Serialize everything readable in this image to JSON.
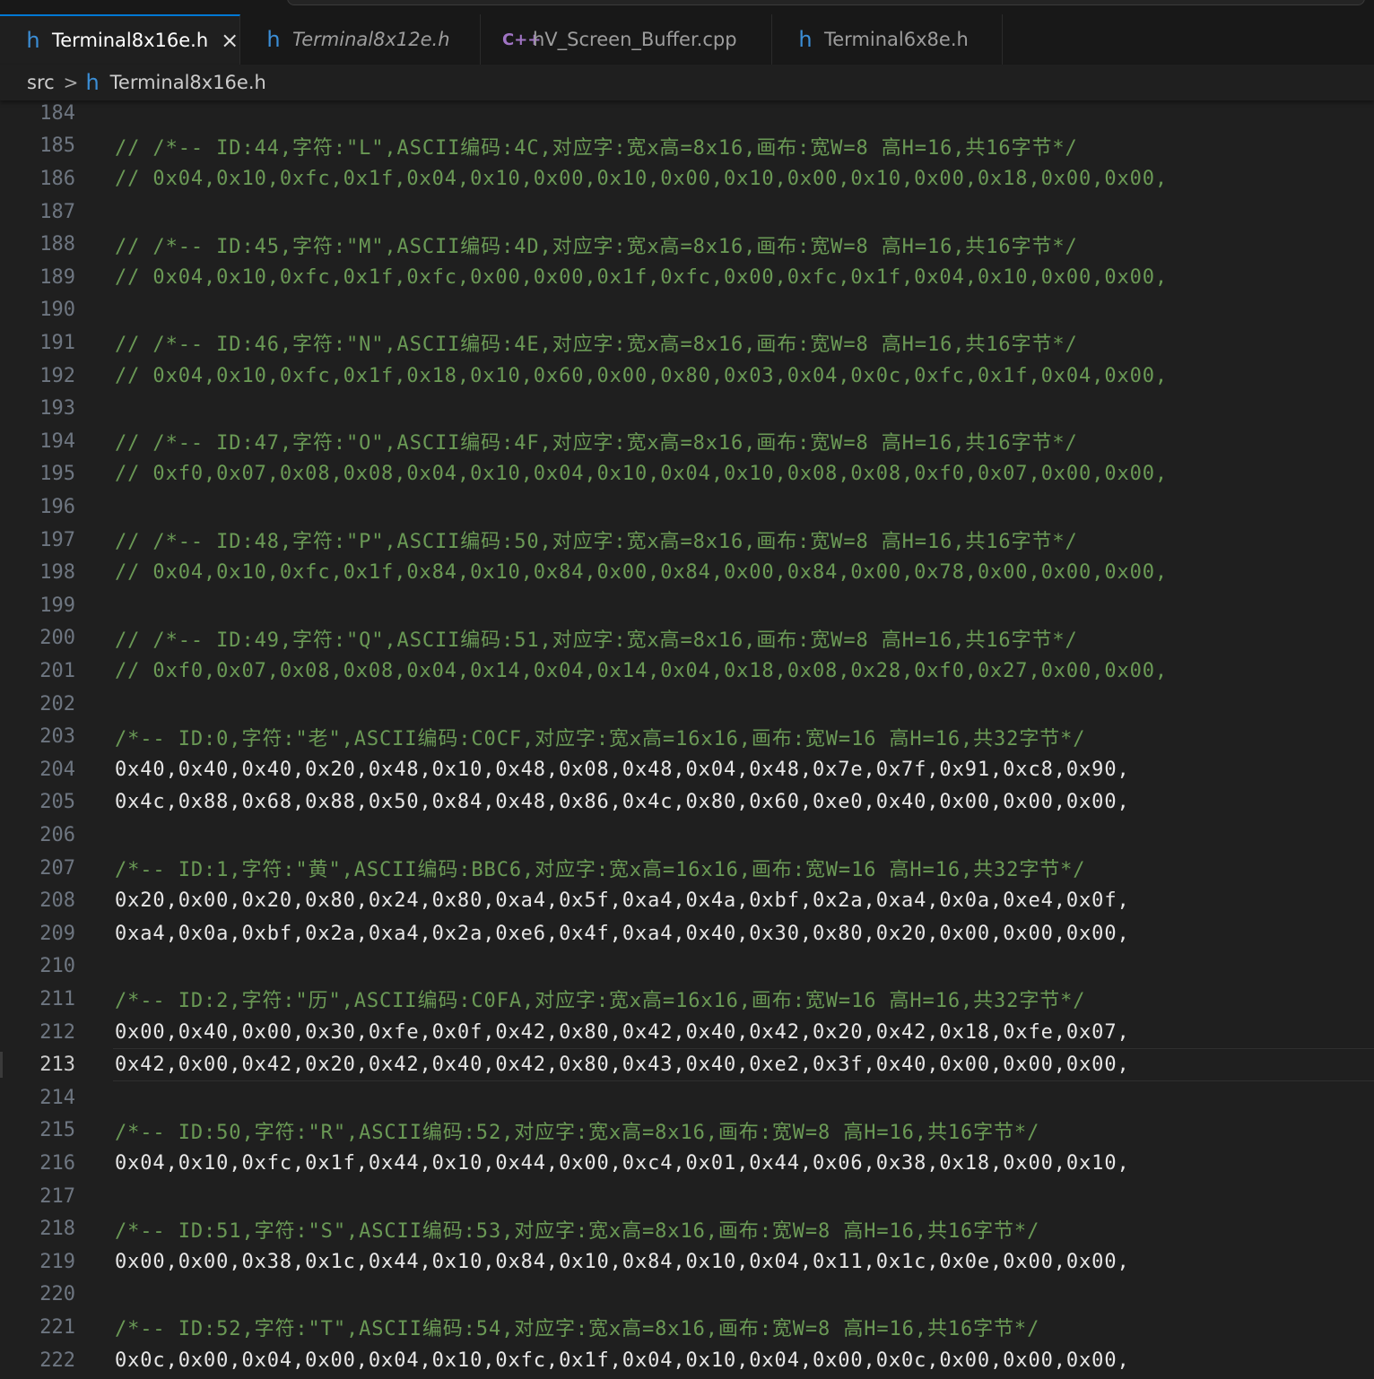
{
  "tabs": [
    {
      "icon": "h",
      "label": "Terminal8x16e.h",
      "active": true,
      "italic": false,
      "close": "×"
    },
    {
      "icon": "h",
      "label": "Terminal8x12e.h",
      "active": false,
      "italic": true
    },
    {
      "icon": "C++",
      "label": "hV_Screen_Buffer.cpp",
      "active": false,
      "italic": false
    },
    {
      "icon": "h",
      "label": "Terminal6x8e.h",
      "active": false,
      "italic": false
    }
  ],
  "breadcrumb": {
    "folder": "src",
    "separator": ">",
    "file_icon": "h",
    "file": "Terminal8x16e.h"
  },
  "editor": {
    "current_line": "213",
    "lines": [
      {
        "n": "184",
        "t": "",
        "k": "data"
      },
      {
        "n": "185",
        "t": "// /*-- ID:44,字符:\"L\",ASCII编码:4C,对应字:宽x高=8x16,画布:宽W=8 高H=16,共16字节*/",
        "k": "comment"
      },
      {
        "n": "186",
        "t": "// 0x04,0x10,0xfc,0x1f,0x04,0x10,0x00,0x10,0x00,0x10,0x00,0x10,0x00,0x18,0x00,0x00,",
        "k": "comment"
      },
      {
        "n": "187",
        "t": "",
        "k": "data"
      },
      {
        "n": "188",
        "t": "// /*-- ID:45,字符:\"M\",ASCII编码:4D,对应字:宽x高=8x16,画布:宽W=8 高H=16,共16字节*/",
        "k": "comment"
      },
      {
        "n": "189",
        "t": "// 0x04,0x10,0xfc,0x1f,0xfc,0x00,0x00,0x1f,0xfc,0x00,0xfc,0x1f,0x04,0x10,0x00,0x00,",
        "k": "comment"
      },
      {
        "n": "190",
        "t": "",
        "k": "data"
      },
      {
        "n": "191",
        "t": "// /*-- ID:46,字符:\"N\",ASCII编码:4E,对应字:宽x高=8x16,画布:宽W=8 高H=16,共16字节*/",
        "k": "comment"
      },
      {
        "n": "192",
        "t": "// 0x04,0x10,0xfc,0x1f,0x18,0x10,0x60,0x00,0x80,0x03,0x04,0x0c,0xfc,0x1f,0x04,0x00,",
        "k": "comment"
      },
      {
        "n": "193",
        "t": "",
        "k": "data"
      },
      {
        "n": "194",
        "t": "// /*-- ID:47,字符:\"O\",ASCII编码:4F,对应字:宽x高=8x16,画布:宽W=8 高H=16,共16字节*/",
        "k": "comment"
      },
      {
        "n": "195",
        "t": "// 0xf0,0x07,0x08,0x08,0x04,0x10,0x04,0x10,0x04,0x10,0x08,0x08,0xf0,0x07,0x00,0x00,",
        "k": "comment"
      },
      {
        "n": "196",
        "t": "",
        "k": "data"
      },
      {
        "n": "197",
        "t": "// /*-- ID:48,字符:\"P\",ASCII编码:50,对应字:宽x高=8x16,画布:宽W=8 高H=16,共16字节*/",
        "k": "comment"
      },
      {
        "n": "198",
        "t": "// 0x04,0x10,0xfc,0x1f,0x84,0x10,0x84,0x00,0x84,0x00,0x84,0x00,0x78,0x00,0x00,0x00,",
        "k": "comment"
      },
      {
        "n": "199",
        "t": "",
        "k": "data"
      },
      {
        "n": "200",
        "t": "// /*-- ID:49,字符:\"Q\",ASCII编码:51,对应字:宽x高=8x16,画布:宽W=8 高H=16,共16字节*/",
        "k": "comment"
      },
      {
        "n": "201",
        "t": "// 0xf0,0x07,0x08,0x08,0x04,0x14,0x04,0x14,0x04,0x18,0x08,0x28,0xf0,0x27,0x00,0x00,",
        "k": "comment"
      },
      {
        "n": "202",
        "t": "",
        "k": "data"
      },
      {
        "n": "203",
        "t": "/*-- ID:0,字符:\"老\",ASCII编码:C0CF,对应字:宽x高=16x16,画布:宽W=16 高H=16,共32字节*/",
        "k": "comment"
      },
      {
        "n": "204",
        "t": "0x40,0x40,0x40,0x20,0x48,0x10,0x48,0x08,0x48,0x04,0x48,0x7e,0x7f,0x91,0xc8,0x90,",
        "k": "data"
      },
      {
        "n": "205",
        "t": "0x4c,0x88,0x68,0x88,0x50,0x84,0x48,0x86,0x4c,0x80,0x60,0xe0,0x40,0x00,0x00,0x00,",
        "k": "data"
      },
      {
        "n": "206",
        "t": "",
        "k": "data"
      },
      {
        "n": "207",
        "t": "/*-- ID:1,字符:\"黄\",ASCII编码:BBC6,对应字:宽x高=16x16,画布:宽W=16 高H=16,共32字节*/",
        "k": "comment"
      },
      {
        "n": "208",
        "t": "0x20,0x00,0x20,0x80,0x24,0x80,0xa4,0x5f,0xa4,0x4a,0xbf,0x2a,0xa4,0x0a,0xe4,0x0f,",
        "k": "data"
      },
      {
        "n": "209",
        "t": "0xa4,0x0a,0xbf,0x2a,0xa4,0x2a,0xe6,0x4f,0xa4,0x40,0x30,0x80,0x20,0x00,0x00,0x00,",
        "k": "data"
      },
      {
        "n": "210",
        "t": "",
        "k": "data"
      },
      {
        "n": "211",
        "t": "/*-- ID:2,字符:\"历\",ASCII编码:C0FA,对应字:宽x高=16x16,画布:宽W=16 高H=16,共32字节*/",
        "k": "comment"
      },
      {
        "n": "212",
        "t": "0x00,0x40,0x00,0x30,0xfe,0x0f,0x42,0x80,0x42,0x40,0x42,0x20,0x42,0x18,0xfe,0x07,",
        "k": "data"
      },
      {
        "n": "213",
        "t": "0x42,0x00,0x42,0x20,0x42,0x40,0x42,0x80,0x43,0x40,0xe2,0x3f,0x40,0x00,0x00,0x00,",
        "k": "data"
      },
      {
        "n": "214",
        "t": "",
        "k": "data"
      },
      {
        "n": "215",
        "t": "/*-- ID:50,字符:\"R\",ASCII编码:52,对应字:宽x高=8x16,画布:宽W=8 高H=16,共16字节*/",
        "k": "comment"
      },
      {
        "n": "216",
        "t": "0x04,0x10,0xfc,0x1f,0x44,0x10,0x44,0x00,0xc4,0x01,0x44,0x06,0x38,0x18,0x00,0x10,",
        "k": "data"
      },
      {
        "n": "217",
        "t": "",
        "k": "data"
      },
      {
        "n": "218",
        "t": "/*-- ID:51,字符:\"S\",ASCII编码:53,对应字:宽x高=8x16,画布:宽W=8 高H=16,共16字节*/",
        "k": "comment"
      },
      {
        "n": "219",
        "t": "0x00,0x00,0x38,0x1c,0x44,0x10,0x84,0x10,0x84,0x10,0x04,0x11,0x1c,0x0e,0x00,0x00,",
        "k": "data"
      },
      {
        "n": "220",
        "t": "",
        "k": "data"
      },
      {
        "n": "221",
        "t": "/*-- ID:52,字符:\"T\",ASCII编码:54,对应字:宽x高=8x16,画布:宽W=8 高H=16,共16字节*/",
        "k": "comment"
      },
      {
        "n": "222",
        "t": "0x0c,0x00,0x04,0x00,0x04,0x10,0xfc,0x1f,0x04,0x10,0x04,0x00,0x0c,0x00,0x00,0x00,",
        "k": "data"
      }
    ]
  },
  "colors": {
    "comment": "#6a9955",
    "code": "#e6e6e6",
    "line_number": "#6e7681",
    "accent": "#0078d4",
    "header_icon": "#3b8ed6",
    "cpp_icon": "#a074c4"
  }
}
